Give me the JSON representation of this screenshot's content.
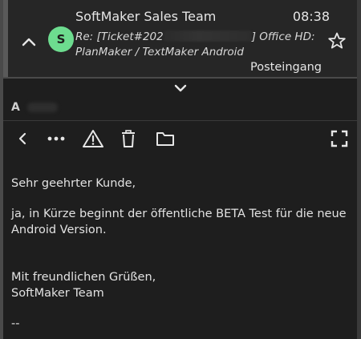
{
  "header": {
    "sender": "SoftMaker Sales Team",
    "time": "08:38",
    "avatar_letter": "S",
    "subject_prefix": "Re: [Ticket#202",
    "subject_suffix": "] Office HD:",
    "subject_line2": "PlanMaker / TextMaker Android",
    "folder": "Posteingang"
  },
  "from": {
    "label": "A"
  },
  "toolbar": {
    "back": "back-icon",
    "more": "more-icon",
    "spam": "warning-icon",
    "delete": "trash-icon",
    "move": "folder-icon",
    "fullscreen": "fullscreen-icon"
  },
  "body": {
    "greeting": "Sehr geehrter Kunde,",
    "paragraph": "ja, in Kürze beginnt der öffentliche BETA Test für die neue Android Version.",
    "closing1": "Mit freundlichen Grüßen,",
    "closing2": "SoftMaker Team",
    "signature_sep": "--"
  },
  "colors": {
    "background": "#1e1e1e",
    "avatar": "#6ddc8f",
    "text": "#e6e6e6"
  }
}
